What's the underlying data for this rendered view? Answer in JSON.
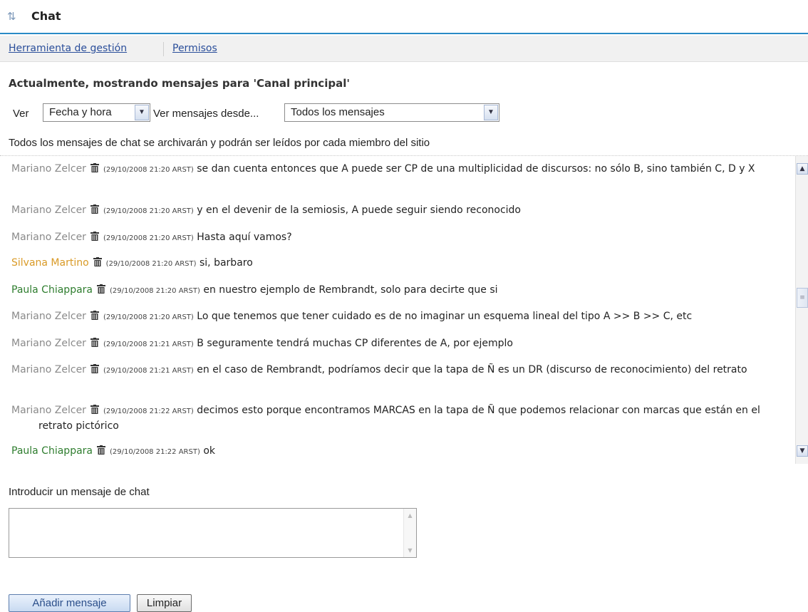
{
  "header": {
    "icon": "swap-arrows-icon",
    "title": "Chat"
  },
  "nav": {
    "items": [
      "Herramienta de gestión",
      "Permisos"
    ]
  },
  "heading": "Actualmente, mostrando mensajes para 'Canal principal'",
  "view": {
    "ver_label": "Ver",
    "ver_value": "Fecha y hora",
    "desde_label": "Ver mensajes desde...",
    "desde_value": "Todos los mensajes"
  },
  "notice": "Todos los mensajes de chat se archivarán y podrán ser leídos por cada miembro del sitio",
  "messages": [
    {
      "author": "Mariano Zelcer",
      "author_color": "gray",
      "timestamp": "(29/10/2008 21:20 ARST)",
      "text": "se dan cuenta entonces que A puede ser CP de una multiplicidad de discursos: no sólo B, sino también C, D y X"
    },
    {
      "author": "Mariano Zelcer",
      "author_color": "gray",
      "timestamp": "(29/10/2008 21:20 ARST)",
      "text": "y en el devenir de la semiosis, A puede seguir siendo reconocido"
    },
    {
      "author": "Mariano Zelcer",
      "author_color": "gray",
      "timestamp": "(29/10/2008 21:20 ARST)",
      "text": "Hasta aquí vamos?"
    },
    {
      "author": "Silvana Martino",
      "author_color": "orange",
      "timestamp": "(29/10/2008 21:20 ARST)",
      "text": "si, barbaro"
    },
    {
      "author": "Paula Chiappara",
      "author_color": "green",
      "timestamp": "(29/10/2008 21:20 ARST)",
      "text": "en nuestro ejemplo de Rembrandt, solo para decirte que si"
    },
    {
      "author": "Mariano Zelcer",
      "author_color": "gray",
      "timestamp": "(29/10/2008 21:20 ARST)",
      "text": "Lo que tenemos que tener cuidado es de no imaginar un esquema lineal del tipo A >> B >> C, etc"
    },
    {
      "author": "Mariano Zelcer",
      "author_color": "gray",
      "timestamp": "(29/10/2008 21:21 ARST)",
      "text": "B seguramente tendrá muchas CP diferentes de A, por ejemplo"
    },
    {
      "author": "Mariano Zelcer",
      "author_color": "gray",
      "timestamp": "(29/10/2008 21:21 ARST)",
      "text": "en el caso de Rembrandt, podríamos decir que la tapa de Ñ es un DR (discurso de reconocimiento) del retrato"
    },
    {
      "author": "Mariano Zelcer",
      "author_color": "gray",
      "timestamp": "(29/10/2008 21:22 ARST)",
      "text": "decimos esto porque encontramos MARCAS en la tapa de Ñ que podemos relacionar con marcas que están en el retrato pictórico"
    },
    {
      "author": "Paula Chiappara",
      "author_color": "green",
      "timestamp": "(29/10/2008 21:22 ARST)",
      "text": "ok"
    }
  ],
  "compose": {
    "label": "Introducir un mensaje de chat",
    "value": ""
  },
  "buttons": {
    "add": "Añadir mensaje",
    "clear": "Limpiar"
  },
  "colors": {
    "accent": "#2a8bc6",
    "link": "#2a4e9a",
    "author_gray": "#8a8a8a",
    "author_orange": "#d99a26",
    "author_green": "#2e7d2e"
  }
}
